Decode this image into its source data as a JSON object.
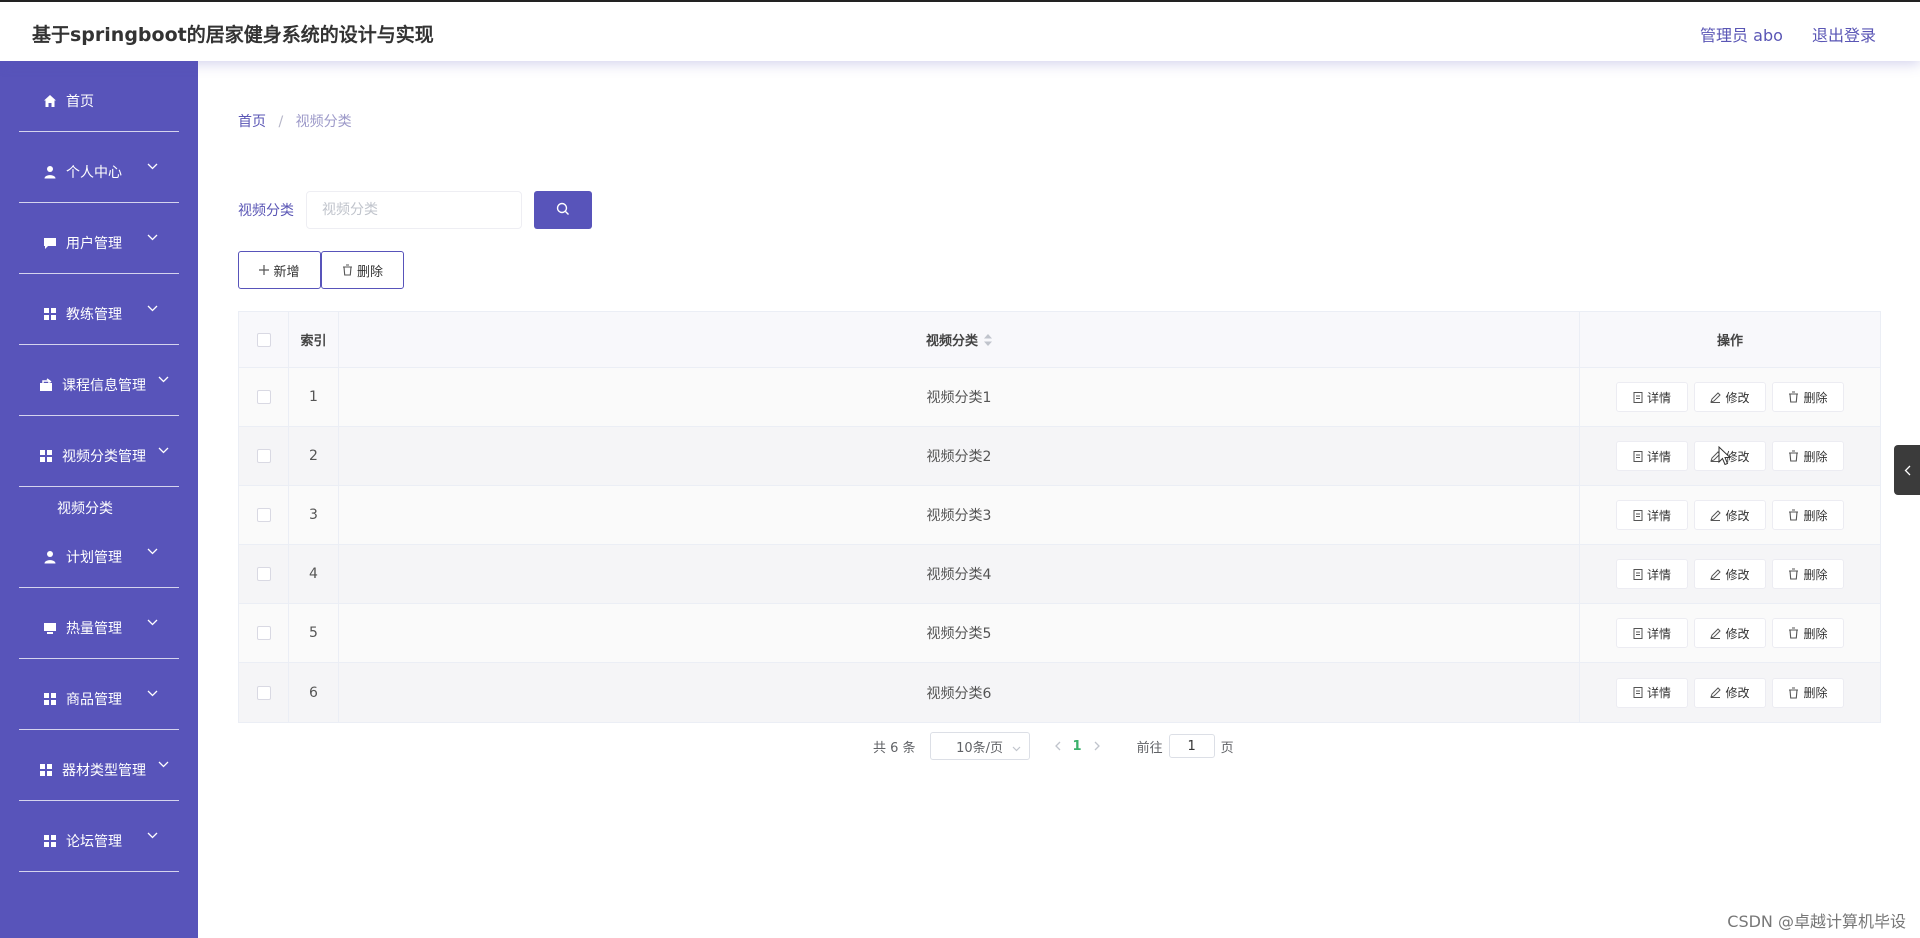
{
  "app": {
    "title": "基于springboot的居家健身系统的设计与实现"
  },
  "header": {
    "admin_label": "管理员 abo",
    "logout_label": "退出登录"
  },
  "sidebar": {
    "items": [
      {
        "label": "首页",
        "icon": "home-icon"
      },
      {
        "label": "个人中心",
        "icon": "user-icon"
      },
      {
        "label": "用户管理",
        "icon": "chat-icon"
      },
      {
        "label": "教练管理",
        "icon": "grid-icon"
      },
      {
        "label": "课程信息管理",
        "icon": "briefcase-icon"
      },
      {
        "label": "视频分类管理",
        "icon": "grid-icon"
      },
      {
        "label": "计划管理",
        "icon": "user-icon"
      },
      {
        "label": "热量管理",
        "icon": "monitor-icon"
      },
      {
        "label": "商品管理",
        "icon": "grid-icon"
      },
      {
        "label": "器材类型管理",
        "icon": "grid-icon"
      },
      {
        "label": "论坛管理",
        "icon": "grid-icon"
      }
    ],
    "submenu": {
      "label": "视频分类"
    }
  },
  "breadcrumb": {
    "home": "首页",
    "separator": "/",
    "current": "视频分类"
  },
  "search": {
    "label": "视频分类",
    "placeholder": "视频分类",
    "value": ""
  },
  "actions": {
    "add_label": "新增",
    "delete_label": "删除"
  },
  "table": {
    "headers": {
      "index": "索引",
      "category": "视频分类",
      "operations": "操作"
    },
    "rows": [
      {
        "index": "1",
        "category": "视频分类1"
      },
      {
        "index": "2",
        "category": "视频分类2"
      },
      {
        "index": "3",
        "category": "视频分类3"
      },
      {
        "index": "4",
        "category": "视频分类4"
      },
      {
        "index": "5",
        "category": "视频分类5"
      },
      {
        "index": "6",
        "category": "视频分类6"
      }
    ],
    "row_buttons": {
      "detail": "详情",
      "edit": "修改",
      "delete": "删除"
    }
  },
  "pagination": {
    "total": "共 6 条",
    "page_size": "10条/页",
    "current_page": "1",
    "goto_label": "前往",
    "goto_value": "1",
    "page_suffix": "页"
  },
  "watermark": "CSDN @卓越计算机毕设",
  "colors": {
    "accent": "#5854ba",
    "sidebar_bg": "#5854ba",
    "active_page": "#3bb16b"
  }
}
